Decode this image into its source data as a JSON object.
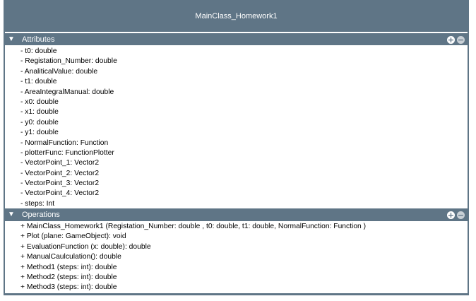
{
  "class_name": "MainClass_Homework1",
  "attributes": {
    "title": "Attributes",
    "expand_glyph": "▼",
    "add_symbol": "+",
    "remove_symbol": "−",
    "items": [
      "- t0: double",
      "- Registation_Number: double",
      "- AnaliticalValue: double",
      "- t1: double",
      "- AreaIntegralManual: double",
      "- x0: double",
      "- x1: double",
      "- y0: double",
      "- y1: double",
      "- NormalFunction: Function",
      "- plotterFunc: FunctionPlotter",
      "- VectorPoint_1: Vector2",
      "- VectorPoint_2: Vector2",
      "- VectorPoint_3: Vector2",
      "- VectorPoint_4: Vector2",
      "- steps: Int"
    ]
  },
  "operations": {
    "title": "Operations",
    "expand_glyph": "▼",
    "add_symbol": "+",
    "remove_symbol": "−",
    "items": [
      "+ MainClass_Homework1 (Registation_Number: double , t0: double, t1: double, NormalFunction: Function )",
      "+ Plot (plane: GameObject): void",
      "+ EvaluationFunction (x: double): double",
      "+ ManualCaulculation(): double",
      "+ Method1 (steps: int): double",
      "+ Method2 (steps: int): double",
      "+ Method3 (steps: int): double"
    ]
  },
  "colors": {
    "frame": "#5f7586",
    "body": "#ffffff"
  }
}
